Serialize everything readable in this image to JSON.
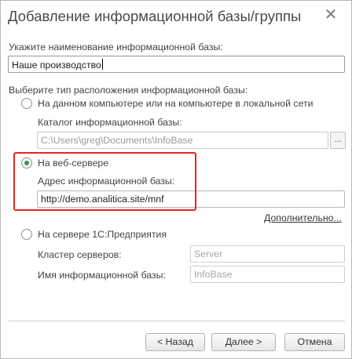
{
  "window": {
    "title": "Добавление информационной базы/группы",
    "close_glyph": "✕"
  },
  "name_section": {
    "label": "Укажите наименование информационной базы:",
    "value": "Наше производство"
  },
  "location": {
    "label": "Выберите тип расположения информационной базы:",
    "options": [
      {
        "label": "На данном компьютере или на компьютере в локальной сети",
        "selected": false,
        "field_label": "Каталог информационной базы:",
        "field_value": "C:\\Users\\greg\\Documents\\InfoBase",
        "browse_label": "..."
      },
      {
        "label": "На веб-сервере",
        "selected": true,
        "field_label": "Адрес информационной базы:",
        "field_value": "http://demo.analitica.site/mnf",
        "advanced_link": "Дополнительно..."
      },
      {
        "label": "На сервере 1С:Предприятия",
        "selected": false,
        "cluster_label": "Кластер серверов:",
        "cluster_placeholder": "Server",
        "db_name_label": "Имя информационной базы:",
        "db_name_placeholder": "InfoBase"
      }
    ]
  },
  "buttons": {
    "back": "< Назад",
    "next": "Далее >",
    "cancel": "Отмена"
  },
  "colors": {
    "highlight": "#e52424",
    "radio_selected": "#2f9a4a"
  }
}
